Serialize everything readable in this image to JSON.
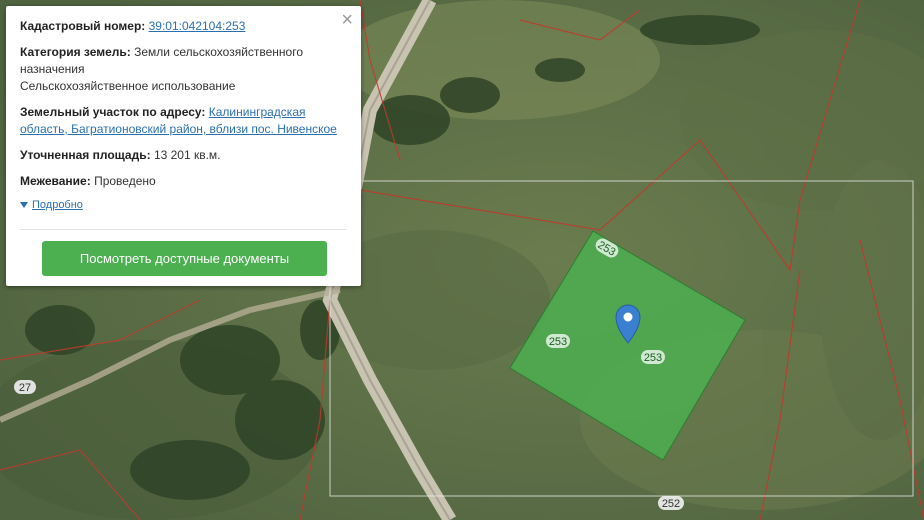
{
  "popup": {
    "cadastral_label": "Кадастровый номер:",
    "cadastral_value": "39:01:042104:253",
    "category_label": "Категория земель:",
    "category_value": "Земли сельскохозяйственного назначения",
    "usage_value": "Сельскохозяйственное использование",
    "address_label": "Земельный участок по адресу:",
    "address_value": "Калининградская область, Багратионовский район, вблизи пос. Нивенское",
    "area_label": "Уточненная площадь:",
    "area_value": "13 201 кв.м.",
    "survey_label": "Межевание:",
    "survey_value": "Проведено",
    "more_label": "Подробно",
    "docs_button": "Посмотреть доступные документы",
    "close_glyph": "×"
  },
  "map": {
    "parcel_labels": [
      "253",
      "253",
      "253"
    ],
    "road_labels": [
      "27",
      "252"
    ],
    "parcel_color": "#4caf50",
    "marker_color": "#3b7fd1",
    "boundary_color": "#c0392b"
  }
}
